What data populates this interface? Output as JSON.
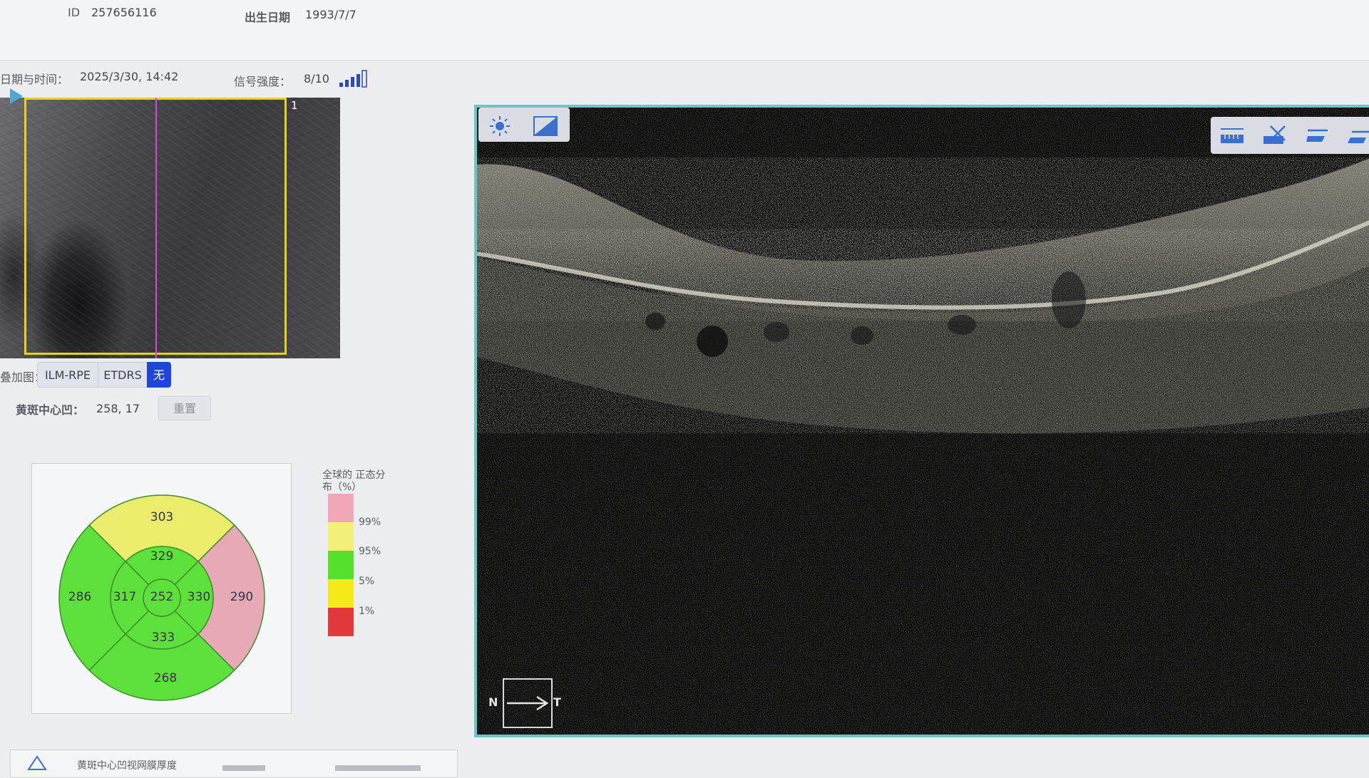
{
  "patient": {
    "id_label": "ID",
    "id_value": "257656116",
    "dob_label": "出生日期",
    "dob_value": "1993/7/7"
  },
  "scan_info": {
    "datetime_label": "日期与时间：",
    "datetime_value": "2025/3/30, 14:42",
    "signal_label": "信号强度：",
    "signal_value": "8/10",
    "signal_level": 0.8
  },
  "fundus": {
    "index_label": "1",
    "scan_box_color": "#e5d21e",
    "scan_line_color": "#d24adb"
  },
  "overlay": {
    "label": "叠加图：",
    "options": [
      "ILM-RPE",
      "ETDRS",
      "无"
    ],
    "selected": "无"
  },
  "fovea": {
    "label": "黄斑中心凹：",
    "value": "258, 17",
    "reset_label": "重置"
  },
  "etdrs": {
    "center": "252",
    "inner": {
      "superior": "329",
      "nasal": "317",
      "inferior": "333",
      "temporal": "330"
    },
    "outer": {
      "superior": "303",
      "nasal": "286",
      "inferior": "268",
      "temporal": "290"
    },
    "colors": {
      "center": "#5ee03c",
      "inner_superior": "#5ee03c",
      "inner_nasal": "#5ee03c",
      "inner_inferior": "#5ee03c",
      "inner_temporal": "#5ee03c",
      "outer_superior": "#ecec6c",
      "outer_nasal": "#5ee03c",
      "outer_inferior": "#5ee03c",
      "outer_temporal": "#e8a9b6"
    }
  },
  "legend": {
    "title_line1": "全球的 正态分",
    "title_line2": "布（%）",
    "bands": [
      {
        "color": "#f0a7b8"
      },
      {
        "color": "#f2f07a"
      },
      {
        "color": "#55e02c"
      },
      {
        "color": "#f4ea1a"
      },
      {
        "color": "#e23a3a"
      }
    ],
    "thresholds": [
      "99%",
      "95%",
      "5%",
      "1%"
    ]
  },
  "bscan": {
    "border_color": "#68c6c4",
    "left_tools": [
      "brightness-icon",
      "contrast-icon"
    ],
    "right_tools": [
      "ruler-icon",
      "delete-measure-icon",
      "layer-flat-icon",
      "layer-edit-icon"
    ],
    "orientation_left": "N",
    "orientation_right": "T"
  },
  "bottom": {
    "section_title": "黄斑中心凹视网膜厚度"
  }
}
